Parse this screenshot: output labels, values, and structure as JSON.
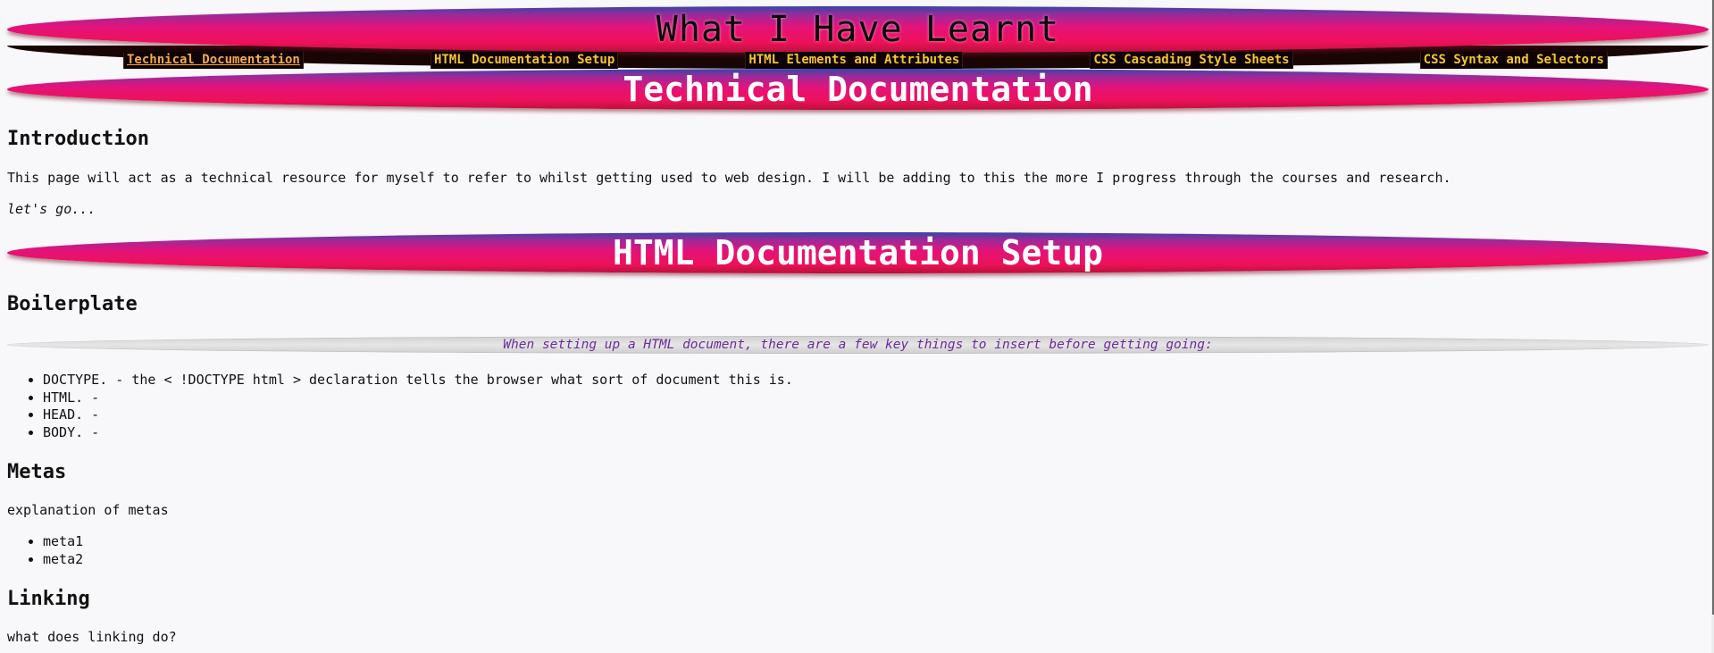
{
  "header": {
    "title": "What I Have Learnt"
  },
  "nav": {
    "links": [
      "Technical Documentation",
      "HTML Documentation Setup",
      "HTML Elements and Attributes",
      "CSS Cascading Style Sheets",
      "CSS Syntax and Selectors"
    ]
  },
  "sections": {
    "tech_doc": {
      "title": "Technical Documentation",
      "intro_heading": "Introduction",
      "intro_text": "This page will act as a technical resource for myself to refer to whilst getting used to web design. I will be adding to this the more I progress through the courses and research.",
      "intro_note": "let's go..."
    },
    "html_setup": {
      "title": "HTML Documentation Setup",
      "boilerplate_heading": "Boilerplate",
      "callout": "When setting up a HTML document, there are a few key things to insert before getting going:",
      "boilerplate_items": [
        "DOCTYPE. - the < !DOCTYPE html > declaration tells the browser what sort of document this is.",
        "HTML. -",
        "HEAD. -",
        "BODY. -"
      ],
      "metas_heading": "Metas",
      "metas_text": "explanation of metas",
      "metas_items": [
        "meta1",
        "meta2"
      ],
      "linking_heading": "Linking",
      "linking_text": "what does linking do?"
    }
  },
  "colors": {
    "banner_top": "#3446a8",
    "banner_mid": "#e4127a",
    "banner_bottom": "#b8113c",
    "nav_background": "#1a0505",
    "nav_link": "#f5c531",
    "callout_text": "#6e2a9a",
    "page_background": "#f8f8fa"
  }
}
